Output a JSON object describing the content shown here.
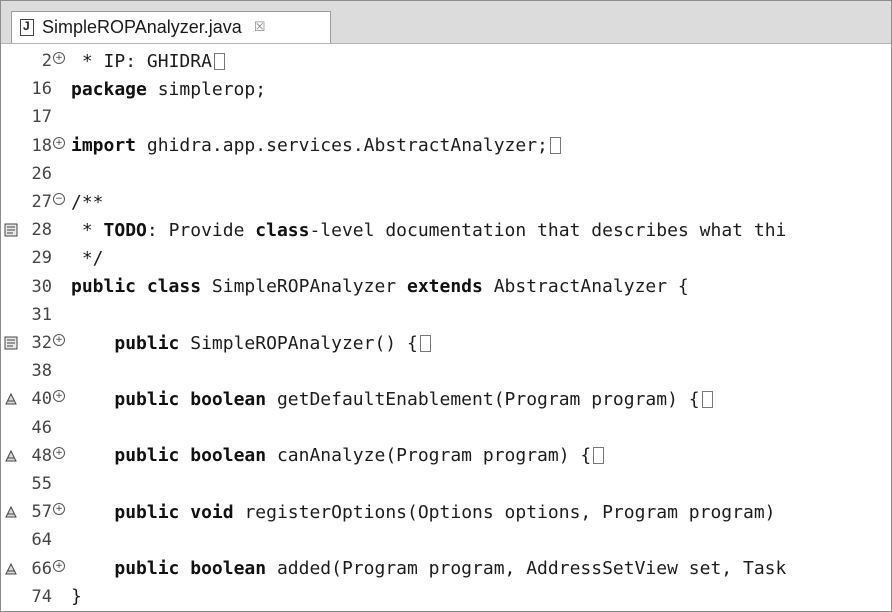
{
  "tab": {
    "title": "SimpleROPAnalyzer.java",
    "close_glyph": "☒"
  },
  "lines": [
    {
      "num": "2",
      "fold": "+",
      "marker": "",
      "code": " * IP: GHIDRA",
      "collapsed": true
    },
    {
      "num": "16",
      "fold": "",
      "marker": "",
      "code": "package simplerop;",
      "collapsed": false
    },
    {
      "num": "17",
      "fold": "",
      "marker": "",
      "code": "",
      "collapsed": false
    },
    {
      "num": "18",
      "fold": "+",
      "marker": "",
      "code": "import ghidra.app.services.AbstractAnalyzer;",
      "collapsed": true
    },
    {
      "num": "26",
      "fold": "",
      "marker": "",
      "code": "",
      "collapsed": false
    },
    {
      "num": "27",
      "fold": "-",
      "marker": "",
      "code": "/**",
      "collapsed": false
    },
    {
      "num": "28",
      "fold": "",
      "marker": "task",
      "code": " * TODO: Provide class-level documentation that describes what thi",
      "collapsed": false
    },
    {
      "num": "29",
      "fold": "",
      "marker": "",
      "code": " */",
      "collapsed": false
    },
    {
      "num": "30",
      "fold": "",
      "marker": "",
      "code": "public class SimpleROPAnalyzer extends AbstractAnalyzer {",
      "collapsed": false
    },
    {
      "num": "31",
      "fold": "",
      "marker": "",
      "code": "",
      "collapsed": false
    },
    {
      "num": "32",
      "fold": "+",
      "marker": "task",
      "code": "    public SimpleROPAnalyzer() {",
      "collapsed": true
    },
    {
      "num": "38",
      "fold": "",
      "marker": "",
      "code": "",
      "collapsed": false
    },
    {
      "num": "40",
      "fold": "+",
      "marker": "override",
      "code": "    public boolean getDefaultEnablement(Program program) {",
      "collapsed": true
    },
    {
      "num": "46",
      "fold": "",
      "marker": "",
      "code": "",
      "collapsed": false
    },
    {
      "num": "48",
      "fold": "+",
      "marker": "override",
      "code": "    public boolean canAnalyze(Program program) {",
      "collapsed": true
    },
    {
      "num": "55",
      "fold": "",
      "marker": "",
      "code": "",
      "collapsed": false
    },
    {
      "num": "57",
      "fold": "+",
      "marker": "override",
      "code": "    public void registerOptions(Options options, Program program)",
      "collapsed": false
    },
    {
      "num": "64",
      "fold": "",
      "marker": "",
      "code": "",
      "collapsed": false
    },
    {
      "num": "66",
      "fold": "+",
      "marker": "override",
      "code": "    public boolean added(Program program, AddressSetView set, Task",
      "collapsed": false
    },
    {
      "num": "74",
      "fold": "",
      "marker": "",
      "code": "}",
      "collapsed": false
    }
  ],
  "keywords": [
    "package",
    "import",
    "public",
    "class",
    "extends",
    "boolean",
    "void",
    "TODO"
  ]
}
